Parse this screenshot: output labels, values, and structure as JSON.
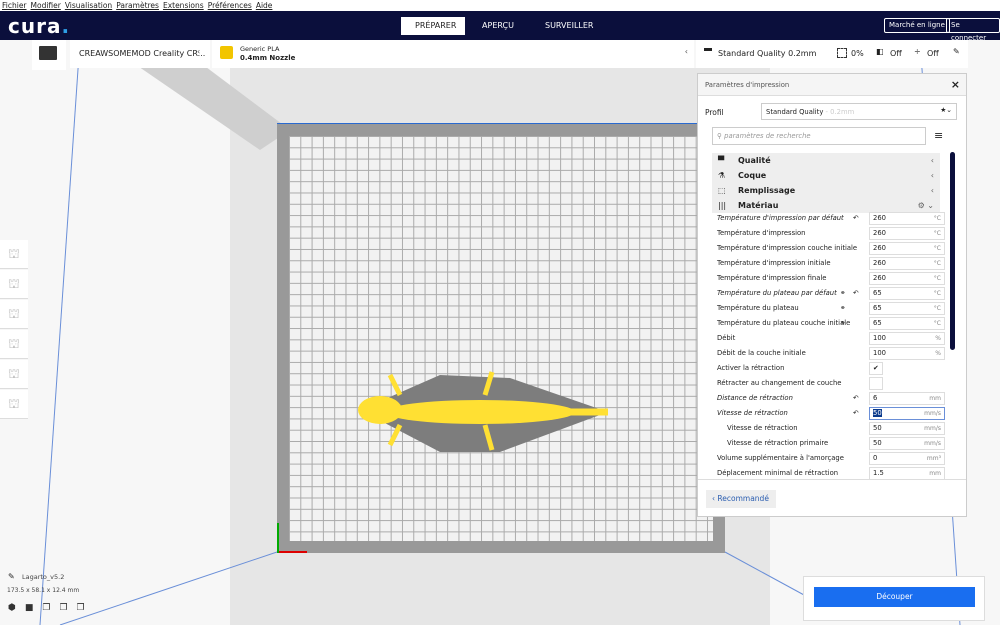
{
  "menu": [
    "Fichier",
    "Modifier",
    "Visualisation",
    "Paramètres",
    "Extensions",
    "Préférences",
    "Aide"
  ],
  "header": {
    "logo": "cura",
    "tabs": [
      "PRÉPARER",
      "APERÇU",
      "SURVEILLER"
    ],
    "marketplace": "Marché en ligne",
    "login": "Se connecter"
  },
  "machine": {
    "name": "CREAWSOMEMOD Creality CR..."
  },
  "material": {
    "name": "Generic PLA",
    "nozzle": "0.4mm Nozzle"
  },
  "print_bar": {
    "profile": "Standard Quality 0.2mm",
    "infill": "0%",
    "support": "Off",
    "adhesion": "Off"
  },
  "panel": {
    "title": "Paramètres d'impression",
    "profile_label": "Profil",
    "profile_value": "Standard Quality",
    "profile_suffix": "- 0.2mm",
    "search_placeholder": "paramètres de recherche",
    "categories": [
      "Qualité",
      "Coque",
      "Remplissage",
      "Matériau"
    ],
    "settings": [
      {
        "label": "Température d'impression par défaut",
        "value": "260",
        "unit": "°C",
        "italic": true,
        "reset": true
      },
      {
        "label": "Température d'impression",
        "value": "260",
        "unit": "°C"
      },
      {
        "label": "Température d'impression couche initiale",
        "value": "260",
        "unit": "°C"
      },
      {
        "label": "Température d'impression initiale",
        "value": "260",
        "unit": "°C"
      },
      {
        "label": "Température d'impression finale",
        "value": "260",
        "unit": "°C"
      },
      {
        "label": "Température du plateau par défaut",
        "value": "65",
        "unit": "°C",
        "italic": true,
        "reset": true,
        "link": true
      },
      {
        "label": "Température du plateau",
        "value": "65",
        "unit": "°C",
        "link": true
      },
      {
        "label": "Température du plateau couche initiale",
        "value": "65",
        "unit": "°C",
        "link": true
      },
      {
        "label": "Débit",
        "value": "100",
        "unit": "%"
      },
      {
        "label": "Débit de la couche initiale",
        "value": "100",
        "unit": "%"
      },
      {
        "label": "Activer la rétraction",
        "check": true
      },
      {
        "label": "Rétracter au changement de couche",
        "check": false
      },
      {
        "label": "Distance de rétraction",
        "value": "6",
        "unit": "mm",
        "italic": true,
        "reset": true
      },
      {
        "label": "Vitesse de rétraction",
        "value": "50",
        "unit": "mm/s",
        "italic": true,
        "reset": true,
        "selected": true
      },
      {
        "label": "Vitesse de rétraction",
        "value": "50",
        "unit": "mm/s",
        "indent": true
      },
      {
        "label": "Vitesse de rétraction primaire",
        "value": "50",
        "unit": "mm/s",
        "indent": true
      },
      {
        "label": "Volume supplémentaire à l'amorçage",
        "value": "0",
        "unit": "mm³"
      },
      {
        "label": "Déplacement minimal de rétraction",
        "value": "1.5",
        "unit": "mm"
      }
    ],
    "recommended": "Recommandé"
  },
  "object": {
    "name": "Lagarto_v5.2",
    "dims": "173.5 x 58.1 x 12.4 mm"
  },
  "slice": {
    "label": "Découper"
  },
  "colors": {
    "header": "#0b0f3c",
    "accent": "#196ef0",
    "model": "#ffe033"
  }
}
